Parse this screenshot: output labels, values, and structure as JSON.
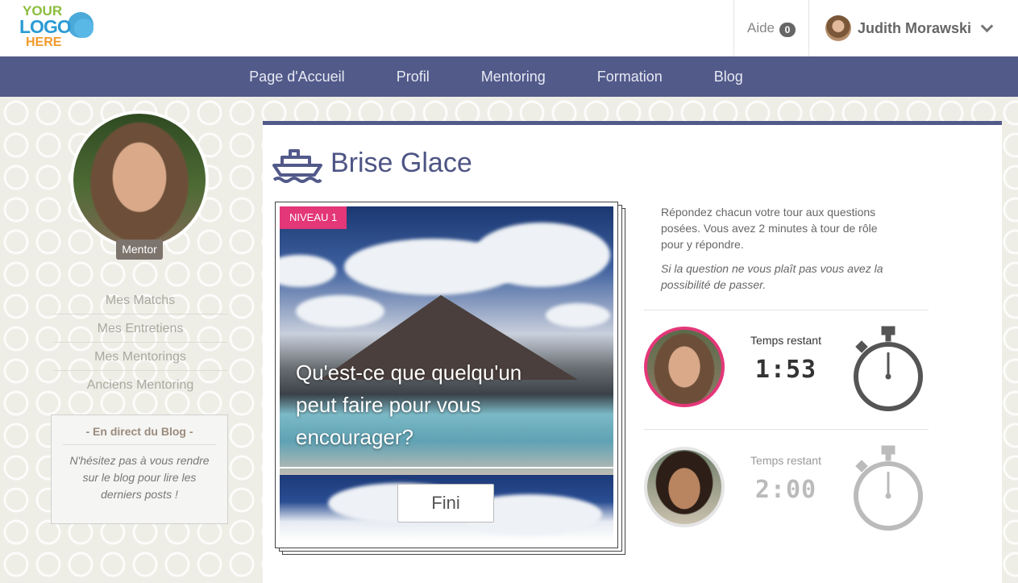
{
  "header": {
    "logo": {
      "line1": "YOUR",
      "line2": "LOGO",
      "line3": "HERE"
    },
    "aide_label": "Aide",
    "aide_count": "0",
    "user_name": "Judith Morawski"
  },
  "nav": {
    "items": [
      {
        "label": "Page d'Accueil"
      },
      {
        "label": "Profil"
      },
      {
        "label": "Mentoring"
      },
      {
        "label": "Formation"
      },
      {
        "label": "Blog"
      }
    ]
  },
  "sidebar": {
    "role_tag": "Mentor",
    "menu": [
      {
        "label": "Mes Matchs"
      },
      {
        "label": "Mes Entretiens"
      },
      {
        "label": "Mes Mentorings"
      },
      {
        "label": "Anciens Mentoring"
      }
    ],
    "blog": {
      "title": "- En direct du Blog -",
      "text": "N'hésitez pas à vous rendre sur le blog pour lire les derniers posts !"
    }
  },
  "main": {
    "icon": "ship-icon",
    "title": "Brise Glace",
    "card": {
      "level_badge": "NIVEAU 1",
      "question": "Qu'est-ce que quelqu'un peut faire pour vous encourager?",
      "done_button": "Fini"
    },
    "instructions": {
      "text": "Répondez chacun votre tour aux questions posées. Vous avez 2 minutes à tour de rôle pour y répondre.",
      "italic": "Si la question ne vous plaît pas vous avez la possibilité de passer."
    },
    "timers": [
      {
        "label": "Temps restant",
        "value": "1:53",
        "active": true
      },
      {
        "label": "Temps restant",
        "value": "2:00",
        "active": false
      }
    ]
  },
  "colors": {
    "nav_bg": "#525a8a",
    "accent_pink": "#e33778",
    "title_color": "#4e5584"
  }
}
